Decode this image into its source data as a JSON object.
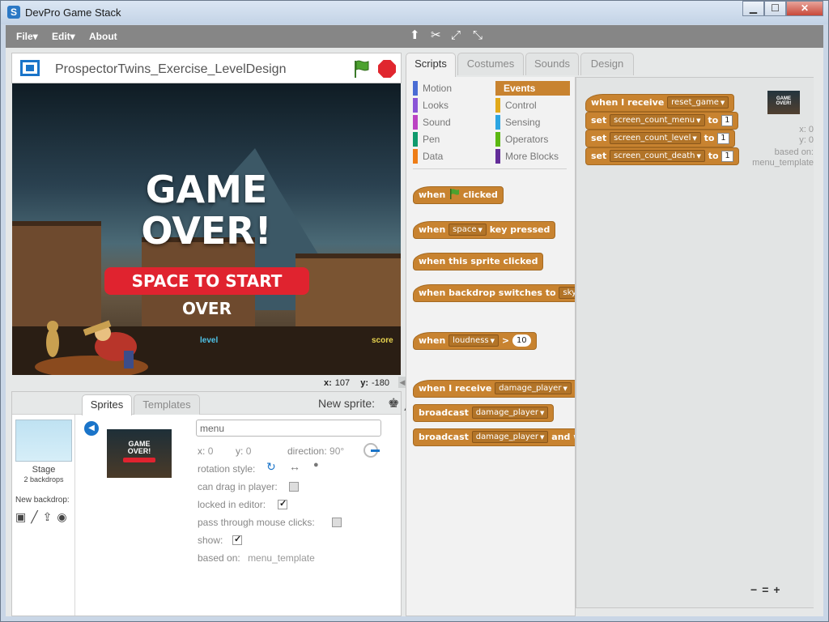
{
  "window": {
    "title": "DevPro Game Stack",
    "app_icon": "S",
    "buttons": {
      "minimize": "▁",
      "maximize": "☐",
      "close": "✕"
    }
  },
  "menubar": {
    "file": "File▾",
    "edit": "Edit▾",
    "about": "About",
    "tools": [
      "duplicate-icon",
      "cut-icon",
      "grow-icon",
      "shrink-icon"
    ]
  },
  "stage": {
    "project_title": "ProspectorTwins_Exercise_LevelDesign",
    "game_over_line1": "GAME",
    "game_over_line2": "OVER!",
    "start_over": "SPACE TO START OVER",
    "hud_level": "level",
    "hud_score": "score",
    "coords": {
      "x_label": "x:",
      "x": "107",
      "y_label": "y:",
      "y": "-180"
    }
  },
  "sprite_panel": {
    "stage_label": "Stage",
    "backdrops": "2 backdrops",
    "new_backdrop": "New backdrop:",
    "tab_sprites": "Sprites",
    "tab_templates": "Templates",
    "new_sprite": "New sprite:",
    "thumb_line1": "GAME",
    "thumb_line2": "OVER!",
    "name": "menu",
    "x_label": "x:",
    "x": "0",
    "y_label": "y:",
    "y": "0",
    "direction_label": "direction:",
    "direction": "90°",
    "rotation_style": "rotation style:",
    "can_drag": "can drag in player:",
    "locked": "locked in editor:",
    "pass_through": "pass through mouse clicks:",
    "show": "show:",
    "based_on_label": "based on:",
    "based_on": "menu_template",
    "checks": {
      "can_drag": false,
      "locked": true,
      "pass_through": false,
      "show": true
    }
  },
  "tabs": {
    "scripts": "Scripts",
    "costumes": "Costumes",
    "sounds": "Sounds",
    "design": "Design"
  },
  "categories": [
    {
      "label": "Motion",
      "color": "#4a6cd4"
    },
    {
      "label": "Events",
      "color": "#c88330"
    },
    {
      "label": "Looks",
      "color": "#8a55d7"
    },
    {
      "label": "Control",
      "color": "#e1a91a"
    },
    {
      "label": "Sound",
      "color": "#bb42c3"
    },
    {
      "label": "Sensing",
      "color": "#2ca5e2"
    },
    {
      "label": "Pen",
      "color": "#0e9a6c"
    },
    {
      "label": "Operators",
      "color": "#5cb712"
    },
    {
      "label": "Data",
      "color": "#ee7d16"
    },
    {
      "label": "More Blocks",
      "color": "#632d99"
    }
  ],
  "palette_blocks": {
    "flag_when": "when",
    "flag_clicked": "clicked",
    "key_when": "when",
    "key_value": "space",
    "key_pressed": "key pressed",
    "sprite_clicked": "when this sprite clicked",
    "backdrop_switch": "when backdrop switches to",
    "backdrop_value": "sky_b",
    "loudness_when": "when",
    "loudness_value": "loudness",
    "loudness_op": ">",
    "loudness_num": "10",
    "receive_when": "when I receive",
    "receive_value": "damage_player",
    "broadcast": "broadcast",
    "broadcast_value": "damage_player",
    "broadcast_wait": "broadcast",
    "broadcast_wait_value": "damage_player",
    "broadcast_wait_suffix": "and w"
  },
  "script": {
    "hat": "when I receive",
    "hat_value": "reset_game",
    "set": "set",
    "to": "to",
    "vars": [
      "screen_count_menu",
      "screen_count_level",
      "screen_count_death"
    ],
    "values": [
      "1",
      "1",
      "1"
    ]
  },
  "script_area_info": {
    "x": "x: 0",
    "y": "y: 0",
    "based_on": "based on:",
    "template": "menu_template"
  },
  "zoom": {
    "out": "−",
    "reset": "=",
    "in": "+"
  }
}
